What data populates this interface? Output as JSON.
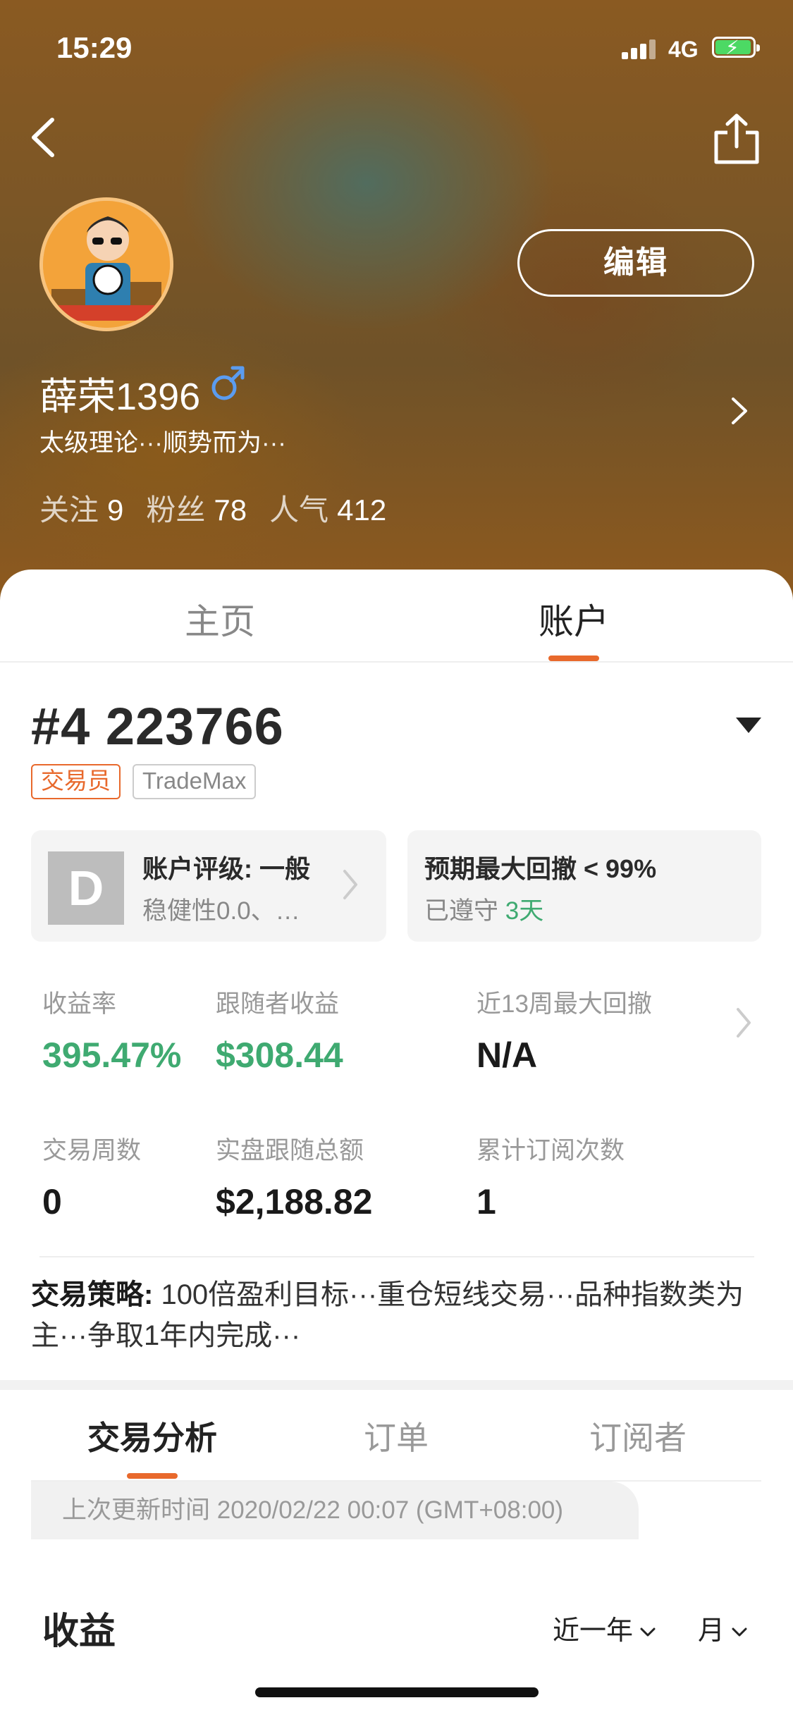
{
  "status_bar": {
    "time": "15:29",
    "network": "4G"
  },
  "profile": {
    "username": "薛荣1396",
    "bio": "太级理论···顺势而为···",
    "edit_label": "编辑",
    "stats": [
      {
        "label": "关注",
        "value": "9"
      },
      {
        "label": "粉丝",
        "value": "78"
      },
      {
        "label": "人气",
        "value": "412"
      }
    ]
  },
  "main_tabs": [
    {
      "label": "主页"
    },
    {
      "label": "账户"
    }
  ],
  "account": {
    "number": "#4 223766",
    "tags": [
      "交易员",
      "TradeMax"
    ],
    "rating_card": {
      "grade": "D",
      "title": "账户评级: 一般",
      "subtitle": "稳健性0.0、…"
    },
    "drawdown_card": {
      "title": "预期最大回撤 < 99%",
      "subtitle_prefix": "已遵守",
      "days": "3天"
    },
    "metrics": [
      {
        "label": "收益率",
        "value": "395.47%"
      },
      {
        "label": "跟随者收益",
        "value": "$308.44"
      },
      {
        "label": "近13周最大回撤",
        "value": "N/A"
      },
      {
        "label": "交易周数",
        "value": "0"
      },
      {
        "label": "实盘跟随总额",
        "value": "$2,188.82"
      },
      {
        "label": "累计订阅次数",
        "value": "1"
      }
    ],
    "strategy_label": "交易策略:",
    "strategy_text": " 100倍盈利目标···重仓短线交易···品种指数类为主···争取1年内完成···"
  },
  "sub_tabs": [
    {
      "label": "交易分析"
    },
    {
      "label": "订单"
    },
    {
      "label": "订阅者"
    }
  ],
  "update_text": "上次更新时间 2020/02/22 00:07 (GMT+08:00)",
  "earnings": {
    "title": "收益",
    "range": "近一年",
    "period": "月"
  },
  "colors": {
    "accent": "#e8692c",
    "positive": "#3faa71",
    "gender_male": "#5b9cf0"
  }
}
